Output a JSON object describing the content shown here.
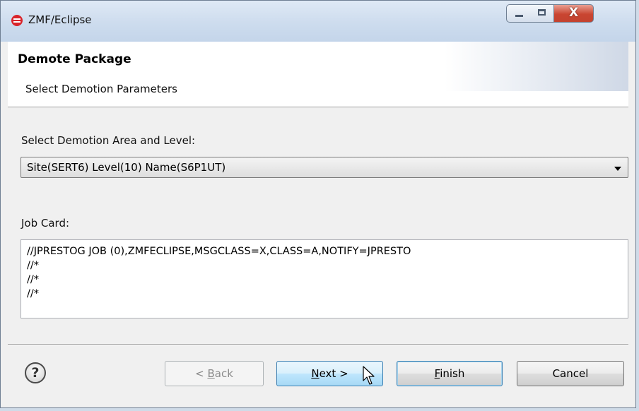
{
  "window": {
    "title": "ZMF/Eclipse",
    "app_icon": "zmf-eclipse-icon",
    "close_glyph": "X"
  },
  "header": {
    "title": "Demote Package",
    "subtitle": "Select Demotion Parameters"
  },
  "demotion": {
    "label": "Select Demotion Area and Level:",
    "selected": "Site(SERT6) Level(10) Name(S6P1UT)"
  },
  "jobcard": {
    "label": "Job Card:",
    "lines": [
      "//JPRESTOG JOB (0),ZMFECLIPSE,MSGCLASS=X,CLASS=A,NOTIFY=JPRESTO",
      "//*",
      "//*",
      "//*"
    ]
  },
  "buttons": {
    "help_glyph": "?",
    "back": {
      "prefix": "< ",
      "mnemonic": "B",
      "rest": "ack",
      "enabled": false
    },
    "next": {
      "mnemonic": "N",
      "rest": "ext >"
    },
    "finish": {
      "mnemonic": "F",
      "rest": "inish"
    },
    "cancel": "Cancel"
  },
  "colors": {
    "titlebar": "#cddcee",
    "close": "#c94531",
    "accent": "#3c7fb1"
  }
}
